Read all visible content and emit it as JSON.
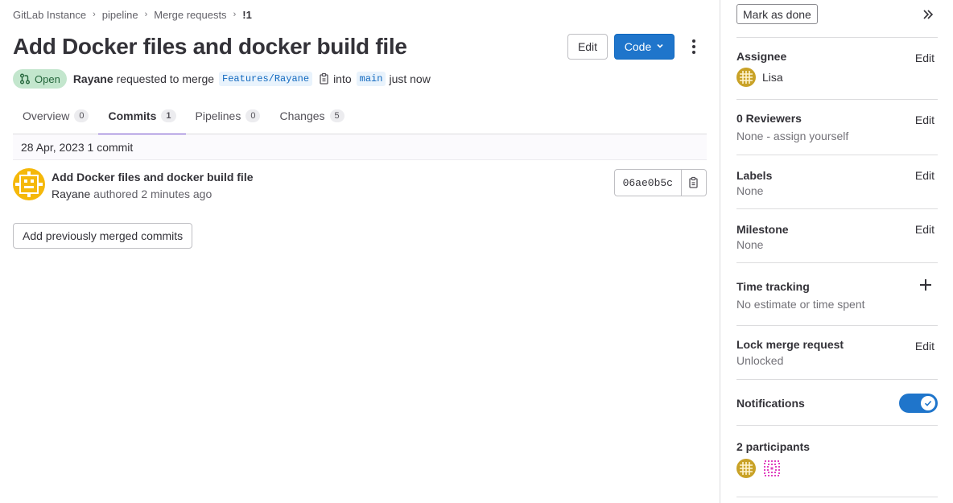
{
  "breadcrumb": {
    "items": [
      "GitLab Instance",
      "pipeline",
      "Merge requests"
    ],
    "current": "!1"
  },
  "mr": {
    "title": "Add Docker files and docker build file",
    "status": "Open",
    "author": "Rayane",
    "requested_text": "requested to merge",
    "source_branch": "Features/Rayane",
    "into_text": "into",
    "target_branch": "main",
    "time": "just now"
  },
  "header": {
    "edit_label": "Edit",
    "code_label": "Code"
  },
  "tabs": [
    {
      "label": "Overview",
      "count": "0"
    },
    {
      "label": "Commits",
      "count": "1"
    },
    {
      "label": "Pipelines",
      "count": "0"
    },
    {
      "label": "Changes",
      "count": "5"
    }
  ],
  "commits": {
    "date_header": "28 Apr, 2023 1 commit",
    "items": [
      {
        "title": "Add Docker files and docker build file",
        "author": "Rayane",
        "authored_text": "authored 2 minutes ago",
        "sha": "06ae0b5c"
      }
    ],
    "add_previous_label": "Add previously merged commits"
  },
  "sidebar": {
    "mark_done_label": "Mark as done",
    "assignee": {
      "heading": "Assignee",
      "action": "Edit",
      "name": "Lisa"
    },
    "reviewers": {
      "heading": "0 Reviewers",
      "action": "Edit",
      "value": "None - assign yourself"
    },
    "labels": {
      "heading": "Labels",
      "action": "Edit",
      "value": "None"
    },
    "milestone": {
      "heading": "Milestone",
      "action": "Edit",
      "value": "None"
    },
    "time_tracking": {
      "heading": "Time tracking",
      "value": "No estimate or time spent"
    },
    "lock": {
      "heading": "Lock merge request",
      "action": "Edit",
      "value": "Unlocked"
    },
    "notifications": {
      "heading": "Notifications",
      "enabled": true
    },
    "participants": {
      "heading": "2 participants"
    }
  },
  "colors": {
    "primary": "#1f75cb",
    "open_badge_bg": "#c3e6cd",
    "open_badge_text": "#24663b",
    "tab_active": "#6e49cb",
    "avatar_lisa": "#c9a227",
    "avatar_pink": "#e040c0"
  },
  "icons": [
    "merge-request-icon",
    "copy-icon",
    "chevron-down-icon",
    "kebab-icon",
    "collapse-double-chevron-icon",
    "plus-icon",
    "check-icon"
  ]
}
